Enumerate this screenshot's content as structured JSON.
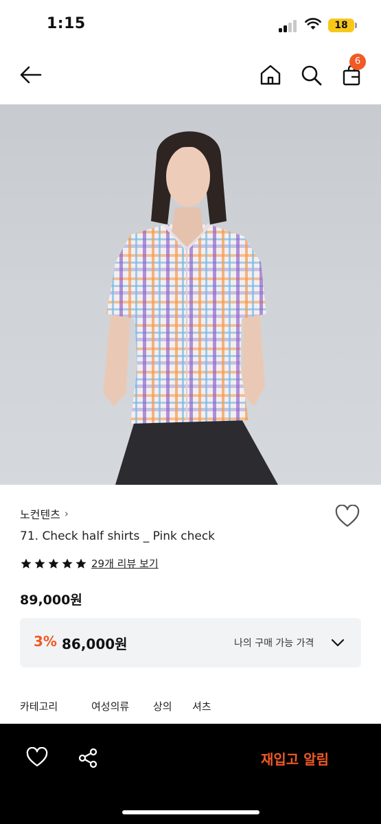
{
  "status": {
    "time": "1:15",
    "battery": "18"
  },
  "nav": {
    "cart_count": "6"
  },
  "product": {
    "brand": "노컨텐츠",
    "name": "71. Check half shirts _ Pink check",
    "rating_stars": 5,
    "review_link": "29개 리뷰 보기",
    "price": "89,000원"
  },
  "purchase": {
    "discount": "3%",
    "price": "86,000원",
    "label": "나의 구매 가능 가격"
  },
  "category": {
    "label": "카테고리",
    "items": [
      "여성의류",
      "상의",
      "셔츠"
    ]
  },
  "bottom_bar": {
    "restock_label": "재입고 알림"
  },
  "colors": {
    "accent": "#f15a24",
    "bottom_bar": "#000000",
    "box_bg": "#f2f3f5"
  }
}
